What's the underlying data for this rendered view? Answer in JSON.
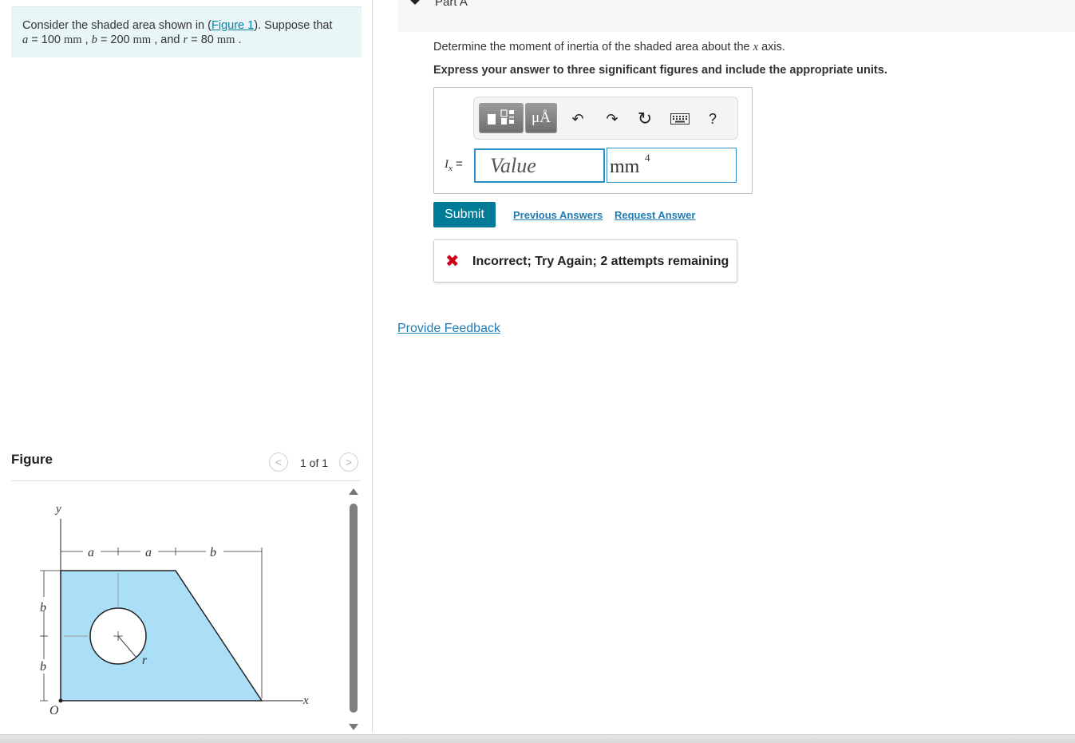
{
  "problem": {
    "prefix": "Consider the shaded area shown in (",
    "figure_link": "Figure 1",
    "suffix": "). Suppose that",
    "a_var": "a",
    "a_eq": " = 100 ",
    "a_unit": "mm",
    "b_var": "b",
    "b_eq": " = 200 ",
    "b_unit": "mm",
    "and": " , and ",
    "r_var": "r",
    "r_eq": " = 80 ",
    "r_unit": "mm",
    "comma": " , ",
    "end": " ."
  },
  "figure_panel": {
    "title": "Figure",
    "prev_glyph": "<",
    "next_glyph": ">",
    "count": "1 of 1",
    "labels": {
      "y": "y",
      "x": "x",
      "origin": "O",
      "a1": "a",
      "a2": "a",
      "b_top": "b",
      "b_upper": "b",
      "b_lower": "b",
      "r": "r"
    }
  },
  "part": {
    "title": "Part A",
    "question_prefix": "Determine the moment of inertia of the shaded area about the ",
    "question_var": "x",
    "question_suffix": " axis.",
    "instruction": "Express your answer to three significant figures and include the appropriate units."
  },
  "answer": {
    "label_var": "I",
    "label_sub": "x",
    "label_eq": " =",
    "value_placeholder": "Value",
    "unit": "mm",
    "unit_exp": "4"
  },
  "toolbar": {
    "templates_icon": "templates-icon",
    "units_label": "μÅ",
    "undo_glyph": "↶",
    "redo_glyph": "↷",
    "reset_glyph": "↻",
    "help_label": "?"
  },
  "actions": {
    "submit": "Submit",
    "previous_answers": "Previous Answers",
    "request_answer": "Request Answer"
  },
  "feedback": {
    "mark": "✖",
    "text": "Incorrect; Try Again; 2 attempts remaining"
  },
  "provide_feedback": "Provide Feedback",
  "colors": {
    "accent": "#007b97",
    "link": "#1f7bb3",
    "error": "#d0021b",
    "shape_fill": "#aadff7",
    "problem_bg": "#e8f6f7"
  }
}
